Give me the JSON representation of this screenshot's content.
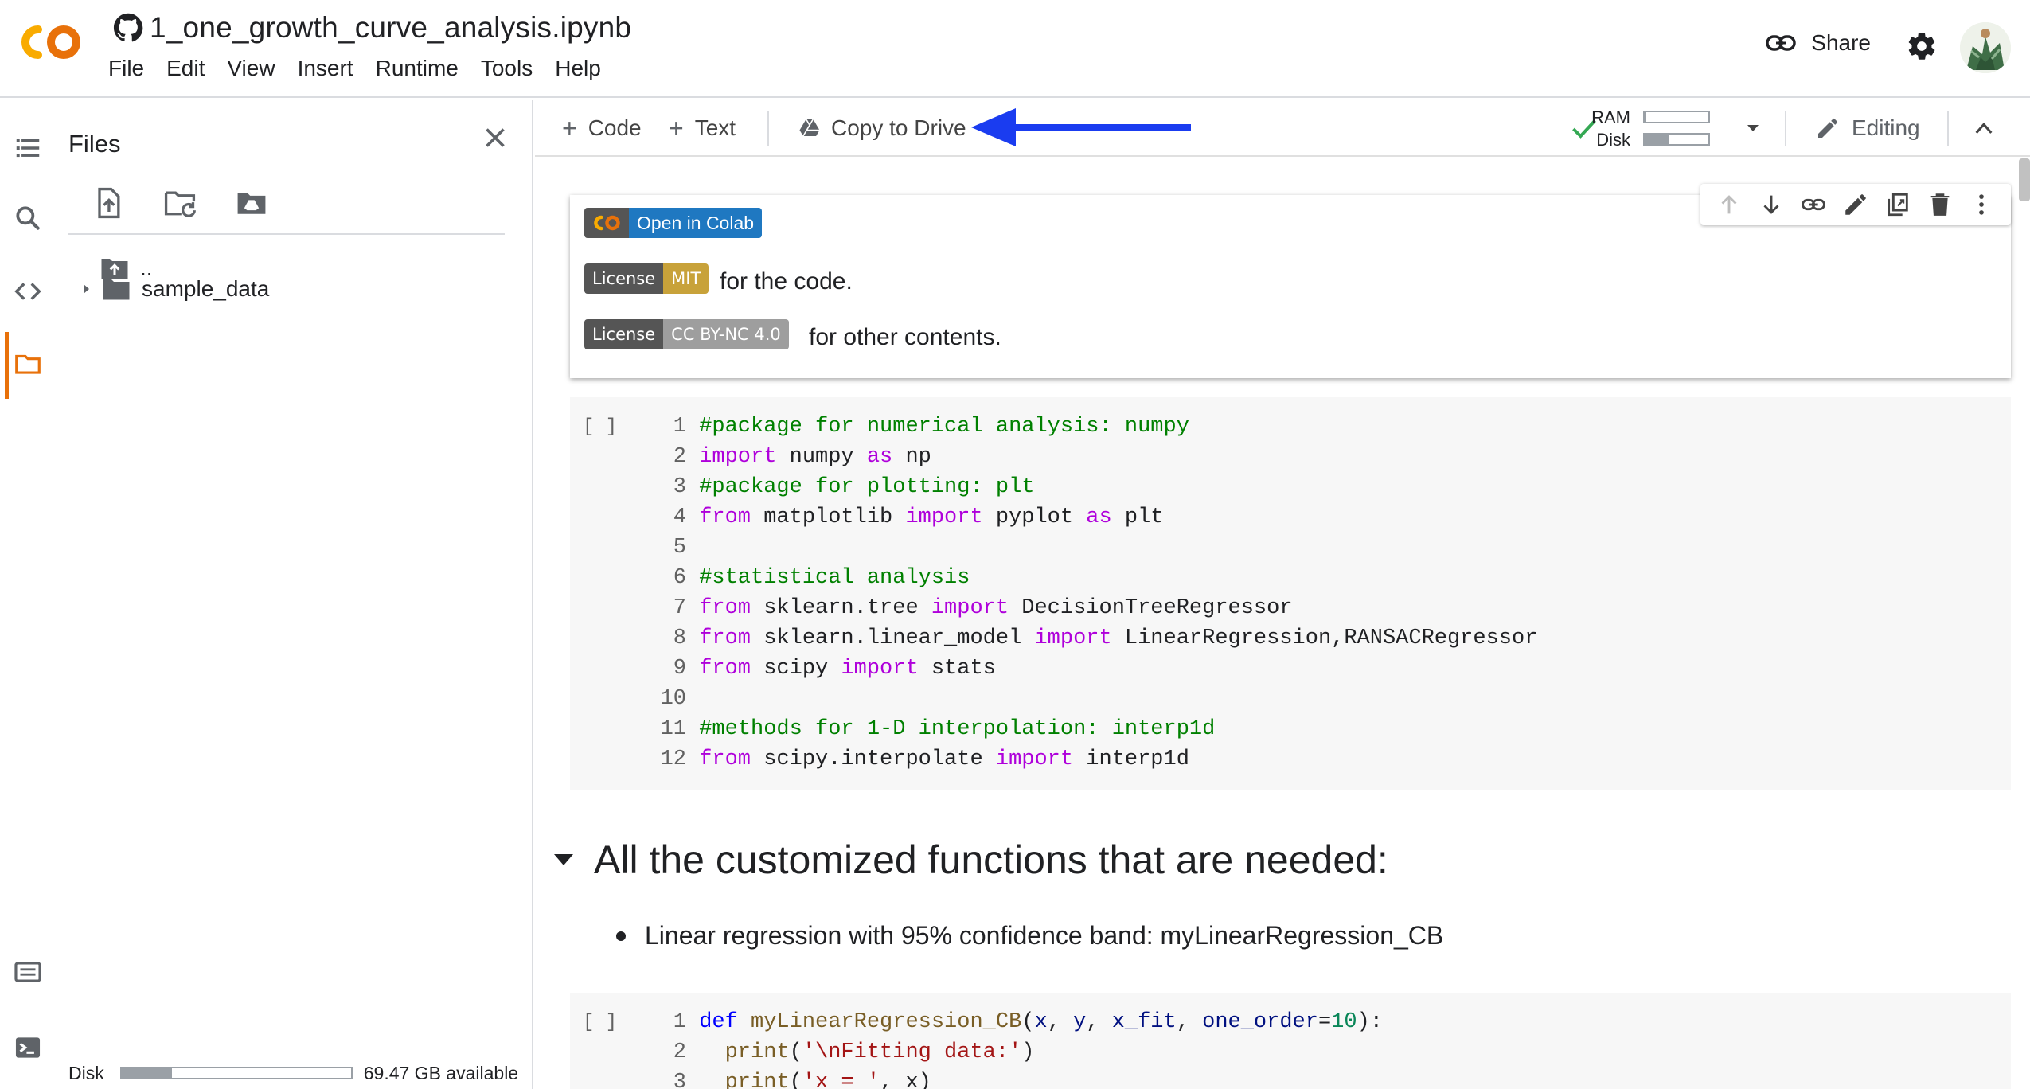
{
  "header": {
    "title": "1_one_growth_curve_analysis.ipynb",
    "menu": [
      "File",
      "Edit",
      "View",
      "Insert",
      "Runtime",
      "Tools",
      "Help"
    ],
    "share_label": "Share"
  },
  "files_panel": {
    "title": "Files",
    "tree": [
      {
        "name": ".."
      },
      {
        "name": "sample_data"
      }
    ],
    "disk_label": "Disk",
    "disk_available": "69.47 GB available",
    "disk_used_fraction": 0.22
  },
  "toolbar": {
    "code_label": "Code",
    "text_label": "Text",
    "copy_to_drive_label": "Copy to Drive",
    "ram_label": "RAM",
    "disk_label": "Disk",
    "ram_fraction": 0.02,
    "disk_fraction": 0.38,
    "editing_label": "Editing"
  },
  "text_cell": {
    "open_in_colab": "Open in Colab",
    "license_mit_left": "License",
    "license_mit_right": "MIT",
    "license_mit_suffix": "for the code.",
    "license_cc_left": "License",
    "license_cc_right": "CC BY-NC 4.0",
    "license_cc_suffix": "for other contents."
  },
  "code_cell_1": {
    "run_bracket": "[ ]",
    "line_numbers": [
      "1",
      "2",
      "3",
      "4",
      "5",
      "6",
      "7",
      "8",
      "9",
      "10",
      "11",
      "12"
    ]
  },
  "section": {
    "heading": "All the customized functions that are needed:",
    "bullet": "Linear regression with 95% confidence band: myLinearRegression_CB"
  },
  "code_cell_2": {
    "run_bracket": "[ ]",
    "line_numbers": [
      "1",
      "2",
      "3"
    ]
  },
  "colors": {
    "colab_orange": "#e8710a",
    "blue_arrow": "#1a3cf0",
    "red_arrow": "#f0302a",
    "badge_dark": "#555555",
    "badge_mit": "#c8a23a",
    "badge_cc": "#9e9e9e",
    "open_in_colab_blue": "#1f78c1"
  }
}
